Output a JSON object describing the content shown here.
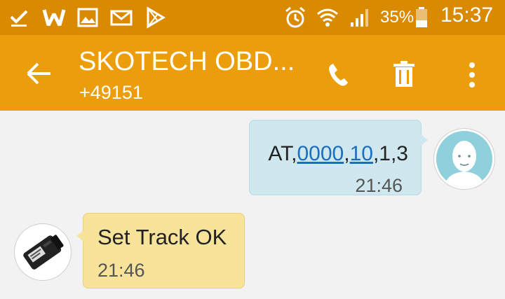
{
  "status_bar": {
    "icons": [
      "download-done-icon",
      "w-app-icon",
      "gallery-icon",
      "mail-icon",
      "play-store-icon",
      "alarm-icon",
      "wifi-icon",
      "signal-icon",
      "battery-icon"
    ],
    "battery_percent": "35%",
    "time": "15:37"
  },
  "header": {
    "title": "SKOTECH OBD...",
    "subtitle": "+49151",
    "actions": [
      "back-arrow-icon",
      "phone-icon",
      "trash-icon",
      "overflow-menu-icon"
    ]
  },
  "messages": {
    "outgoing": {
      "parts": [
        "AT,",
        "0000",
        ",",
        "10",
        ",1,3"
      ],
      "time": "21:46"
    },
    "incoming": {
      "text": "Set Track OK",
      "time": "21:46"
    }
  },
  "colors": {
    "status_bar": "#d98a00",
    "app_bar": "#eb9d0b",
    "background": "#f2f2f2",
    "outgoing_bubble": "#cfe7ef",
    "incoming_bubble": "#f7e39a",
    "link": "#1a6fc0"
  }
}
